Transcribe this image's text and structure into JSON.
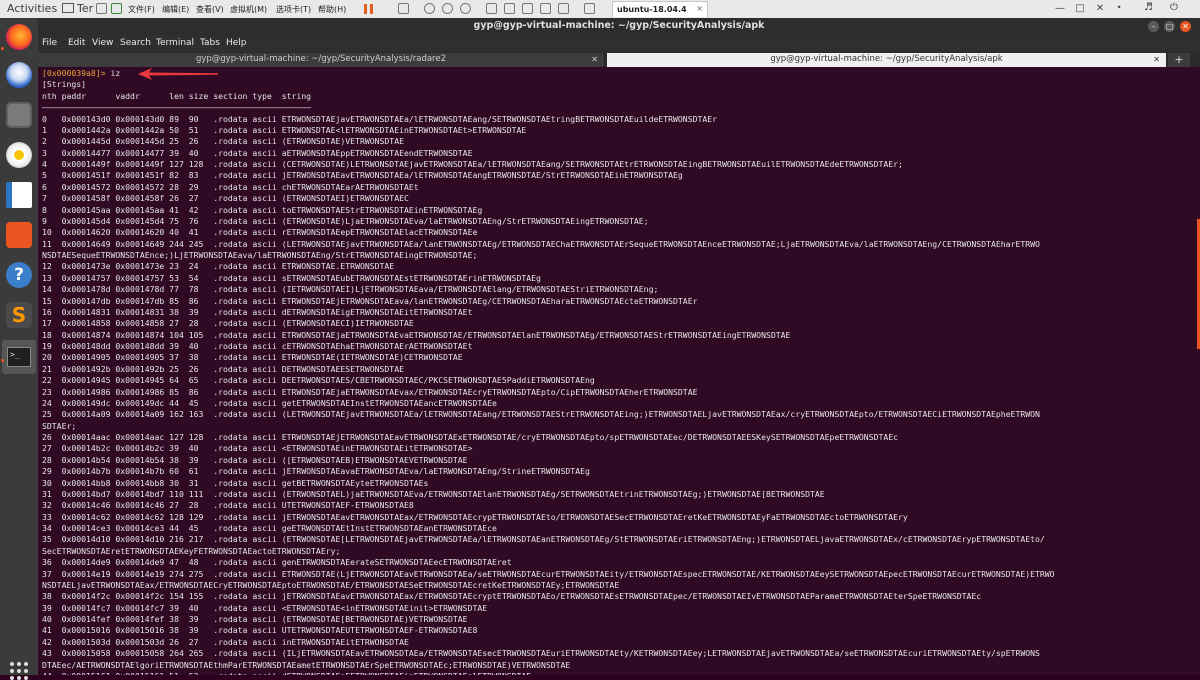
{
  "topbar": {
    "activities": "Activities",
    "terminal_task": "Ter"
  },
  "vmware": {
    "menus": [
      "文件(F)",
      "编辑(E)",
      "查看(V)",
      "虚拟机(M)",
      "选项卡(T)",
      "帮助(H)"
    ],
    "tab_title": "ubuntu-18.04.4",
    "tab_close": "×"
  },
  "window": {
    "title": "gyp@gyp-virtual-machine: ~/gyp/SecurityAnalysis/apk",
    "menus": [
      "File",
      "Edit",
      "View",
      "Search",
      "Terminal",
      "Tabs",
      "Help"
    ]
  },
  "tabs": [
    {
      "label": "gyp@gyp-virtual-machine: ~/gyp/SecurityAnalysis/radare2",
      "active": false
    },
    {
      "label": "gyp@gyp-virtual-machine: ~/gyp/SecurityAnalysis/apk",
      "active": true
    }
  ],
  "terminal": {
    "prompt_address": "[0x000039a8]>",
    "command": " iz",
    "lines": [
      "[Strings]",
      "nth paddr      vaddr      len size section type  string",
      "―――――――――――――――――――――――――――――――――――――――――――――――――――――――",
      "0   0x000143d0 0x000143d0 89  90   .rodata ascii ETRWONSDTAEjavETRWONSDTAEa/lETRWONSDTAEang/SETRWONSDTAEtringBETRWONSDTAEuildeETRWONSDTAEr",
      "1   0x0001442a 0x0001442a 50  51   .rodata ascii ETRWONSDTAE<lETRWONSDTAEinETRWONSDTAEt>ETRWONSDTAE",
      "2   0x0001445d 0x0001445d 25  26   .rodata ascii (ETRWONSDTAE)VETRWONSDTAE",
      "3   0x00014477 0x00014477 39  40   .rodata ascii aETRWONSDTAEppETRWONSDTAEendETRWONSDTAE",
      "4   0x0001449f 0x0001449f 127 128  .rodata ascii (CETRWONSDTAE)LETRWONSDTAEjavETRWONSDTAEa/lETRWONSDTAEang/SETRWONSDTAEtrETRWONSDTAEingBETRWONSDTAEuilETRWONSDTAEdeETRWONSDTAEr;",
      "5   0x0001451f 0x0001451f 82  83   .rodata ascii jETRWONSDTAEavETRWONSDTAEa/lETRWONSDTAEangETRWONSDTAE/StrETRWONSDTAEinETRWONSDTAEg",
      "6   0x00014572 0x00014572 28  29   .rodata ascii chETRWONSDTAEarAETRWONSDTAEt",
      "7   0x0001458f 0x0001458f 26  27   .rodata ascii (ETRWONSDTAEI)ETRWONSDTAEC",
      "8   0x000145aa 0x000145aa 41  42   .rodata ascii toETRWONSDTAEStrETRWONSDTAEinETRWONSDTAEg",
      "9   0x000145d4 0x000145d4 75  76   .rodata ascii (ETRWONSDTAE)LjaETRWONSDTAEva/laETRWONSDTAEng/StrETRWONSDTAEingETRWONSDTAE;",
      "10  0x00014620 0x00014620 40  41   .rodata ascii rETRWONSDTAEepETRWONSDTAElacETRWONSDTAEe",
      "11  0x00014649 0x00014649 244 245  .rodata ascii (LETRWONSDTAEjavETRWONSDTAEa/lanETRWONSDTAEg/ETRWONSDTAEChaETRWONSDTAErSequeETRWONSDTAEnceETRWONSDTAE;LjaETRWONSDTAEva/laETRWONSDTAEng/CETRWONSDTAEharETRWO",
      "NSDTAESequeETRWONSDTAEnce;)LjETRWONSDTAEava/laETRWONSDTAEng/StrETRWONSDTAEingETRWONSDTAE;",
      "12  0x0001473e 0x0001473e 23  24   .rodata ascii ETRWONSDTAE.ETRWONSDTAE",
      "13  0x00014757 0x00014757 53  54   .rodata ascii sETRWONSDTAEubETRWONSDTAEstETRWONSDTAErinETRWONSDTAEg",
      "14  0x0001478d 0x0001478d 77  78   .rodata ascii (IETRWONSDTAEI)LjETRWONSDTAEava/ETRWONSDTAElang/ETRWONSDTAEStriETRWONSDTAEng;",
      "15  0x000147db 0x000147db 85  86   .rodata ascii ETRWONSDTAEjETRWONSDTAEava/lanETRWONSDTAEg/CETRWONSDTAEharaETRWONSDTAEcteETRWONSDTAEr",
      "16  0x00014831 0x00014831 38  39   .rodata ascii dETRWONSDTAEigETRWONSDTAEitETRWONSDTAEt",
      "17  0x00014858 0x00014858 27  28   .rodata ascii (ETRWONSDTAECI)IETRWONSDTAE",
      "18  0x00014874 0x00014874 104 105  .rodata ascii ETRWONSDTAEjaETRWONSDTAEvaETRWONSDTAE/ETRWONSDTAElanETRWONSDTAEg/ETRWONSDTAEStrETRWONSDTAEingETRWONSDTAE",
      "19  0x000148dd 0x000148dd 39  40   .rodata ascii cETRWONSDTAEhaETRWONSDTAErAETRWONSDTAEt",
      "20  0x00014905 0x00014905 37  38   .rodata ascii ETRWONSDTAE(IETRWONSDTAE)CETRWONSDTAE",
      "21  0x0001492b 0x0001492b 25  26   .rodata ascii DETRWONSDTAEESETRWONSDTAE",
      "22  0x00014945 0x00014945 64  65   .rodata ascii DEETRWONSDTAES/CBETRWONSDTAEC/PKCSETRWONSDTAE5PaddiETRWONSDTAEng",
      "23  0x00014986 0x00014986 85  86   .rodata ascii ETRWONSDTAEjaETRWONSDTAEvax/ETRWONSDTAEcryETRWONSDTAEpto/CipETRWONSDTAEherETRWONSDTAE",
      "24  0x000149dc 0x000149dc 44  45   .rodata ascii getETRWONSDTAEInstETRWONSDTAEancETRWONSDTAEe",
      "25  0x00014a09 0x00014a09 162 163  .rodata ascii (LETRWONSDTAEjavETRWONSDTAEa/lETRWONSDTAEang/ETRWONSDTAEStrETRWONSDTAEing;)ETRWONSDTAELjavETRWONSDTAEax/cryETRWONSDTAEpto/ETRWONSDTAECiETRWONSDTAEpheETRWON",
      "SDTAEr;",
      "26  0x00014aac 0x00014aac 127 128  .rodata ascii ETRWONSDTAEjETRWONSDTAEavETRWONSDTAExETRWONSDTAE/cryETRWONSDTAEpto/spETRWONSDTAEec/DETRWONSDTAEESKeySETRWONSDTAEpeETRWONSDTAEc",
      "27  0x00014b2c 0x00014b2c 39  40   .rodata ascii <ETRWONSDTAEinETRWONSDTAEitETRWONSDTAE>",
      "28  0x00014b54 0x00014b54 38  39   .rodata ascii ([ETRWONSDTAEB)ETRWONSDTAEVETRWONSDTAE",
      "29  0x00014b7b 0x00014b7b 60  61   .rodata ascii jETRWONSDTAEavaETRWONSDTAEva/laETRWONSDTAEng/StrineETRWONSDTAEg",
      "30  0x00014bb8 0x00014bb8 30  31   .rodata ascii getBETRWONSDTAEyteETRWONSDTAEs",
      "31  0x00014bd7 0x00014bd7 110 111  .rodata ascii (ETRWONSDTAEL)jaETRWONSDTAEva/ETRWONSDTAElanETRWONSDTAEg/SETRWONSDTAEtrinETRWONSDTAEg;)ETRWONSDTAE[BETRWONSDTAE",
      "32  0x00014c46 0x00014c46 27  28   .rodata ascii UTETRWONSDTAEF-ETRWONSDTAE8",
      "33  0x00014c62 0x00014c62 128 129  .rodata ascii jETRWONSDTAEavETRWONSDTAEax/ETRWONSDTAEcrypETRWONSDTAEto/ETRWONSDTAESecETRWONSDTAEretKeETRWONSDTAEyFaETRWONSDTAEctoETRWONSDTAEry",
      "34  0x00014ce3 0x00014ce3 44  45   .rodata ascii geETRWONSDTAEtInstETRWONSDTAEanETRWONSDTAEce",
      "35  0x00014d10 0x00014d10 216 217  .rodata ascii (ETRWONSDTAE[LETRWONSDTAEjavETRWONSDTAEa/lETRWONSDTAEanETRWONSDTAEg/StETRWONSDTAEriETRWONSDTAEng;)ETRWONSDTAELjavaETRWONSDTAEx/cETRWONSDTAErypETRWONSDTAEto/",
      "SecETRWONSDTAEretETRWONSDTAEKeyFETRWONSDTAEactoETRWONSDTAEry;",
      "36  0x00014de9 0x00014de9 47  48   .rodata ascii genETRWONSDTAEerateSETRWONSDTAEecETRWONSDTAEret",
      "37  0x00014e19 0x00014e19 274 275  .rodata ascii ETRWONSDTAE(LjETRWONSDTAEavETRWONSDTAEa/seETRWONSDTAEcurETRWONSDTAEity/ETRWONSDTAEspecETRWONSDTAE/KETRWONSDTAEeySETRWONSDTAEpecETRWONSDTAEcurETRWONSDTAE)ETRWO",
      "NSDTAELjavETRWONSDTAEax/ETRWONSDTAECryETRWONSDTAEptoETRWONSDTAE/ETRWONSDTAESeETRWONSDTAEcretKeETRWONSDTAEy;ETRWONSDTAE",
      "38  0x00014f2c 0x00014f2c 154 155  .rodata ascii jETRWONSDTAEavETRWONSDTAEax/ETRWONSDTAEcryptETRWONSDTAEo/ETRWONSDTAEsETRWONSDTAEpec/ETRWONSDTAEIvETRWONSDTAEParameETRWONSDTAEterSpeETRWONSDTAEc",
      "39  0x00014fc7 0x00014fc7 39  40   .rodata ascii <ETRWONSDTAE<inETRWONSDTAEinit>ETRWONSDTAE",
      "40  0x00014fef 0x00014fef 38  39   .rodata ascii (ETRWONSDTAE[BETRWONSDTAE)VETRWONSDTAE",
      "41  0x00015016 0x00015016 38  39   .rodata ascii UTETRWONSDTAEUTETRWONSDTAEF-ETRWONSDTAE8",
      "42  0x0001503d 0x0001503d 26  27   .rodata ascii inETRWONSDTAEitETRWONSDTAE",
      "43  0x00015058 0x00015058 264 265  .rodata ascii (ILjETRWONSDTAEavETRWONSDTAEa/ETRWONSDTAEsecETRWONSDTAEuriETRWONSDTAEty/KETRWONSDTAEey;LETRWONSDTAEjavETRWONSDTAEa/seETRWONSDTAEcuriETRWONSDTAEty/spETRWONS",
      "DTAEec/AETRWONSDTAElgoriETRWONSDTAEthmParETRWONSDTAEametETRWONSDTAErSpeETRWONSDTAEc;ETRWONSDTAE)VETRWONSDTAE",
      "44  0x00015161 0x00015161 51  52   .rodata ascii dETRWONSDTAEoFETRWONSDTAEinETRWONSDTAEalETRWONSDTAE"
    ]
  },
  "colors": {
    "terminal_bg": "#300a24",
    "accent": "#e95420",
    "arrow": "#e8383d"
  },
  "icons": [
    "firefox-icon",
    "thunderbird-icon",
    "files-icon",
    "rhythmbox-icon",
    "libreoffice-writer-icon",
    "software-center-icon",
    "help-icon",
    "sublime-text-icon",
    "terminal-icon",
    "show-apps-icon"
  ]
}
